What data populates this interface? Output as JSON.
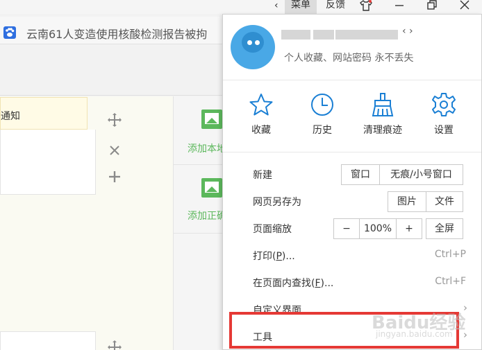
{
  "titlebar": {
    "chevron": "‹",
    "menu_label": "菜单",
    "feedback_label": "反馈"
  },
  "tab": {
    "title": "云南61人变造使用核酸检测报告被拘"
  },
  "page": {
    "notice_text": "通知",
    "add_local_label": "添加本地",
    "add_correct_label": "添加正确"
  },
  "menu": {
    "profile": {
      "chevron": "‹ ›",
      "slogan": "个人收藏、网站密码 永不丢失"
    },
    "quick_actions": [
      {
        "label": "收藏",
        "icon": "star-icon"
      },
      {
        "label": "历史",
        "icon": "clock-icon"
      },
      {
        "label": "清理痕迹",
        "icon": "broom-icon"
      },
      {
        "label": "设置",
        "icon": "gear-icon"
      }
    ],
    "new": {
      "label": "新建",
      "window_label": "窗口",
      "incognito_label": "无痕/小号窗口"
    },
    "save_as": {
      "label": "网页另存为",
      "image_label": "图片",
      "file_label": "文件"
    },
    "zoom": {
      "label": "页面缩放",
      "minus_label": "−",
      "value": "100%",
      "plus_label": "+",
      "fullscreen_label": "全屏"
    },
    "print": {
      "label_prefix": "打印(",
      "label_key": "P",
      "label_suffix": ")...",
      "shortcut": "Ctrl+P"
    },
    "find": {
      "label_prefix": "在页面内查找(",
      "label_key": "F",
      "label_suffix": ")...",
      "shortcut": "Ctrl+F"
    },
    "customize": {
      "label": "自定义界面",
      "arrow": "›"
    },
    "tools": {
      "label": "工具",
      "arrow": "›"
    }
  },
  "watermark": {
    "text": "Baidu经验",
    "sub": "jingyan.baidu.com"
  },
  "colors": {
    "accent_blue": "#1a7fd4",
    "highlight_red": "#e53935",
    "add_green": "#5cb85c"
  }
}
